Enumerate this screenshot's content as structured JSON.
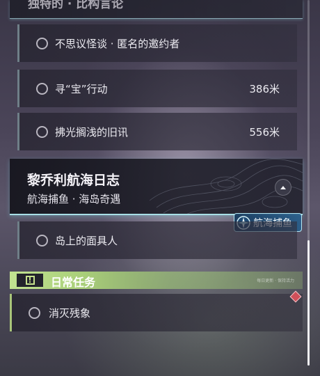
{
  "top_section": {
    "title": "独特的 · 比构言论"
  },
  "tasks": [
    {
      "name": "不思议怪谈 · 匿名的邀约者",
      "distance": ""
    },
    {
      "name": "寻“宝”行动",
      "distance": "386米"
    },
    {
      "name": "拂光搁浅的旧讯",
      "distance": "556米"
    }
  ],
  "chapter": {
    "title": "黎乔利航海日志",
    "subtitle": "航海捕鱼 · 海岛奇遇",
    "collapse_icon": "chevron-up-icon",
    "badge": {
      "icon": "compass-icon",
      "label": "航海捕鱼",
      "color": "#2c6a9c"
    },
    "tasks": [
      {
        "name": "岛上的面具人"
      }
    ]
  },
  "daily": {
    "title": "日常任务",
    "icon": "alert-icon",
    "accent": "#b8d985",
    "faint_text": "每日更新 · 保持活力",
    "tasks": [
      {
        "name": "消灭残象",
        "marker": "diamond-marker-icon",
        "marker_color": "#d0505a"
      }
    ]
  },
  "colors": {
    "chapter_underline": "#a8dfe6",
    "task_bar": "#6f7f88"
  }
}
